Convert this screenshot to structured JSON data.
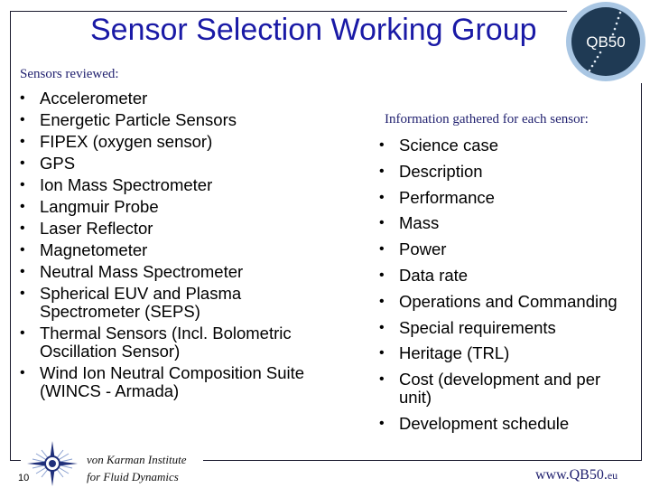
{
  "slide": {
    "title": "Sensor Selection Working Group",
    "page_number": "10"
  },
  "left_column": {
    "label": "Sensors reviewed:",
    "items": [
      "Accelerometer",
      "Energetic Particle Sensors",
      "FIPEX (oxygen sensor)",
      "GPS",
      "Ion Mass Spectrometer",
      "Langmuir Probe",
      "Laser Reflector",
      "Magnetometer",
      "Neutral Mass Spectrometer",
      "Spherical EUV and Plasma Spectrometer (SEPS)",
      "Thermal Sensors (Incl. Bolometric Oscillation Sensor)",
      "Wind Ion Neutral Composition Suite (WINCS - Armada)"
    ]
  },
  "right_column": {
    "label": "Information gathered for each sensor:",
    "items": [
      "Science case",
      "Description",
      "Performance",
      "Mass",
      "Power",
      "Data rate",
      "Operations and Commanding",
      "Special requirements",
      "Heritage (TRL)",
      "Cost (development and per unit)",
      "Development schedule"
    ]
  },
  "bullet_glyph": "•",
  "logo": {
    "icon": "qb50-logo-icon",
    "text": "QB50"
  },
  "footer": {
    "institute_logo_icon": "vki-compass-logo-icon",
    "institute_line1": "von Karman Institute",
    "institute_line2": "for Fluid Dynamics",
    "website_main": "www.QB50.",
    "website_suffix": "eu"
  },
  "colors": {
    "title": "#1a1aa6",
    "label": "#1f1f6e",
    "logo_dark": "#1f3a54",
    "logo_ring": "#a9c6e3",
    "frame": "#1a1a2e"
  }
}
